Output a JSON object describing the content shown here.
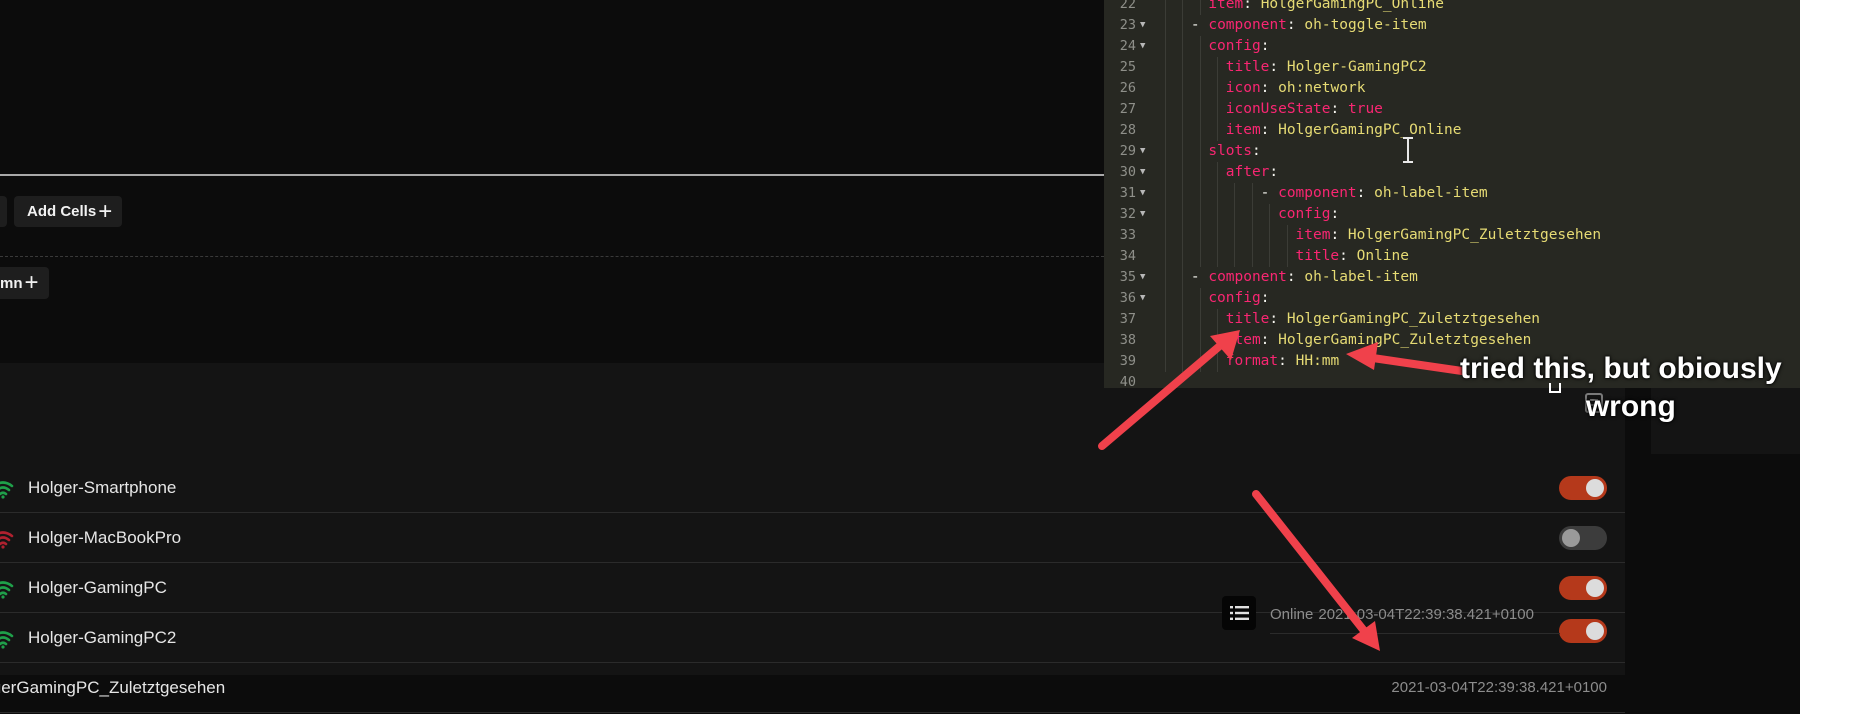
{
  "toolbar": {
    "add_cells_label": "Add Cells",
    "add_column_label": "mn",
    "plus_glyph": "+"
  },
  "items": [
    {
      "label": "Holger-Smartphone",
      "wifi_color": "#1fa04a",
      "state": "on"
    },
    {
      "label": "Holger-MacBookPro",
      "wifi_color": "#b0212f",
      "state": "off"
    },
    {
      "label": "Holger-GamingPC",
      "wifi_color": "#1fa04a",
      "state": "on"
    },
    {
      "label": "Holger-GamingPC2",
      "wifi_color": "#1fa04a",
      "state": "on"
    }
  ],
  "after_slot": {
    "title": "Online",
    "value": "2021-03-04T22:39:38.421+0100"
  },
  "last_row": {
    "label": "lgerGamingPC_Zuletztgesehen",
    "value": "2021-03-04T22:39:38.421+0100"
  },
  "annotation": {
    "line1": "tried this, but obiously",
    "line2": "wrong"
  },
  "colors": {
    "accent": "#b5391b",
    "arrow": "#f0414b",
    "editor_bg": "#272822"
  },
  "editor": {
    "lines": [
      {
        "n": "22",
        "fold": false,
        "indent": 3,
        "tokens": [
          [
            "k",
            "item"
          ],
          [
            "p",
            ": "
          ],
          [
            "v",
            "HolgerGamingPC_Online"
          ]
        ]
      },
      {
        "n": "23",
        "fold": true,
        "indent": 2,
        "tokens": [
          [
            "p",
            "- "
          ],
          [
            "k",
            "component"
          ],
          [
            "p",
            ": "
          ],
          [
            "v",
            "oh-toggle-item"
          ]
        ]
      },
      {
        "n": "24",
        "fold": true,
        "indent": 3,
        "tokens": [
          [
            "k",
            "config"
          ],
          [
            "p",
            ":"
          ]
        ]
      },
      {
        "n": "25",
        "fold": false,
        "indent": 4,
        "tokens": [
          [
            "k",
            "title"
          ],
          [
            "p",
            ": "
          ],
          [
            "v",
            "Holger-GamingPC2"
          ]
        ]
      },
      {
        "n": "26",
        "fold": false,
        "indent": 4,
        "tokens": [
          [
            "k",
            "icon"
          ],
          [
            "p",
            ": "
          ],
          [
            "v",
            "oh:network"
          ]
        ]
      },
      {
        "n": "27",
        "fold": false,
        "indent": 4,
        "tokens": [
          [
            "k",
            "iconUseState"
          ],
          [
            "p",
            ": "
          ],
          [
            "t",
            "true"
          ]
        ]
      },
      {
        "n": "28",
        "fold": false,
        "indent": 4,
        "tokens": [
          [
            "k",
            "item"
          ],
          [
            "p",
            ": "
          ],
          [
            "v",
            "HolgerGamingPC_Online"
          ]
        ]
      },
      {
        "n": "29",
        "fold": true,
        "indent": 3,
        "tokens": [
          [
            "k",
            "slots"
          ],
          [
            "p",
            ":"
          ]
        ]
      },
      {
        "n": "30",
        "fold": true,
        "indent": 4,
        "tokens": [
          [
            "k",
            "after"
          ],
          [
            "p",
            ":"
          ]
        ]
      },
      {
        "n": "31",
        "fold": true,
        "indent": 6,
        "tokens": [
          [
            "p",
            "- "
          ],
          [
            "k",
            "component"
          ],
          [
            "p",
            ": "
          ],
          [
            "v",
            "oh-label-item"
          ]
        ]
      },
      {
        "n": "32",
        "fold": true,
        "indent": 7,
        "tokens": [
          [
            "k",
            "config"
          ],
          [
            "p",
            ":"
          ]
        ]
      },
      {
        "n": "33",
        "fold": false,
        "indent": 8,
        "tokens": [
          [
            "k",
            "item"
          ],
          [
            "p",
            ": "
          ],
          [
            "v",
            "HolgerGamingPC_Zuletztgesehen"
          ]
        ]
      },
      {
        "n": "34",
        "fold": false,
        "indent": 8,
        "tokens": [
          [
            "k",
            "title"
          ],
          [
            "p",
            ": "
          ],
          [
            "v",
            "Online"
          ]
        ]
      },
      {
        "n": "35",
        "fold": true,
        "indent": 2,
        "tokens": [
          [
            "p",
            "- "
          ],
          [
            "k",
            "component"
          ],
          [
            "p",
            ": "
          ],
          [
            "v",
            "oh-label-item"
          ]
        ]
      },
      {
        "n": "36",
        "fold": true,
        "indent": 3,
        "tokens": [
          [
            "k",
            "config"
          ],
          [
            "p",
            ":"
          ]
        ]
      },
      {
        "n": "37",
        "fold": false,
        "indent": 4,
        "tokens": [
          [
            "k",
            "title"
          ],
          [
            "p",
            ": "
          ],
          [
            "v",
            "HolgerGamingPC_Zuletztgesehen"
          ]
        ]
      },
      {
        "n": "38",
        "fold": false,
        "indent": 4,
        "tokens": [
          [
            "k",
            "item"
          ],
          [
            "p",
            ": "
          ],
          [
            "v",
            "HolgerGamingPC_Zuletztgesehen"
          ]
        ]
      },
      {
        "n": "39",
        "fold": false,
        "indent": 4,
        "tokens": [
          [
            "k",
            "format"
          ],
          [
            "p",
            ": "
          ],
          [
            "v",
            "HH:mm"
          ]
        ]
      },
      {
        "n": "40",
        "fold": false,
        "indent": 0,
        "tokens": []
      }
    ]
  }
}
